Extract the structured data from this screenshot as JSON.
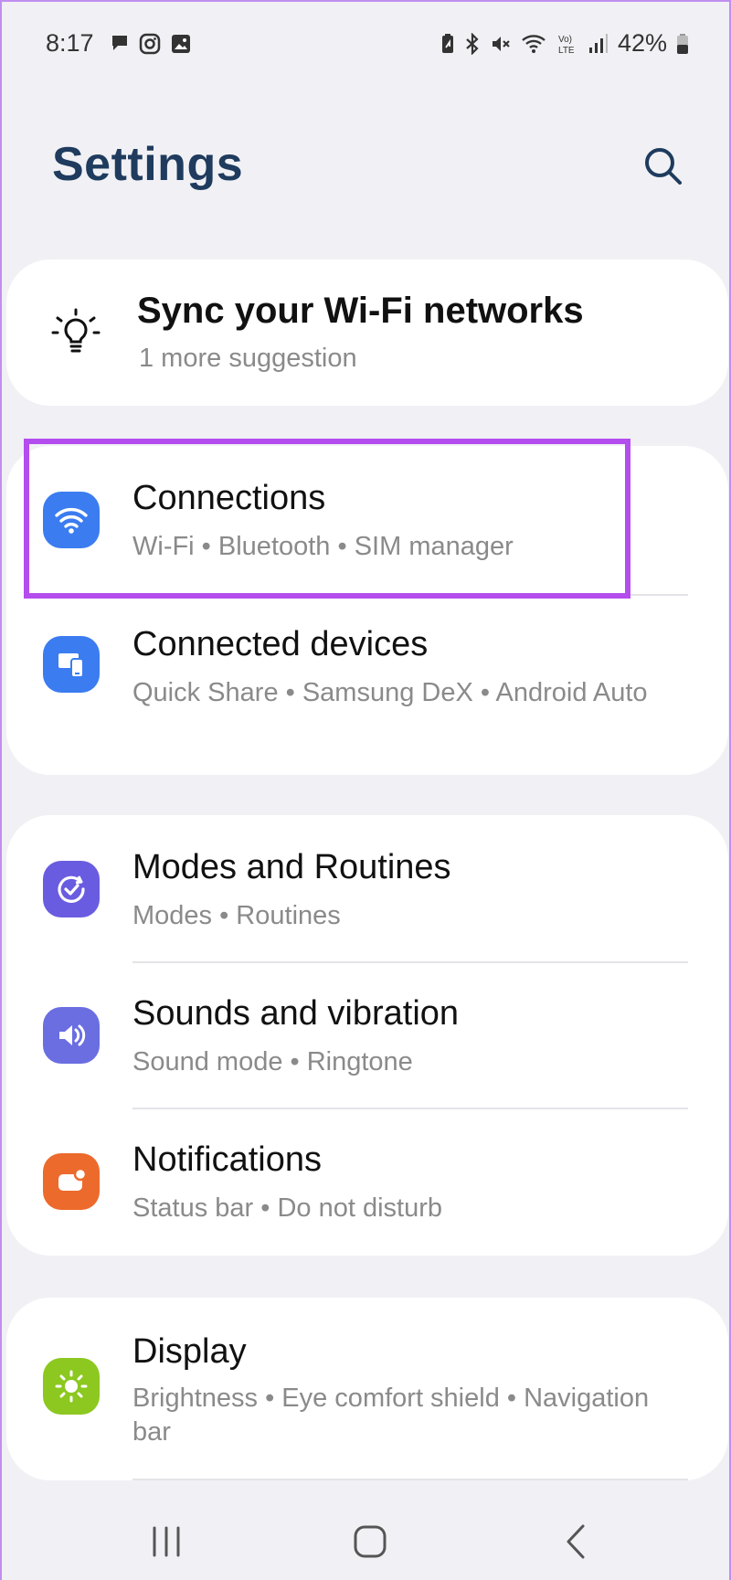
{
  "status_bar": {
    "time": "8:17",
    "battery_text": "42%",
    "left_icons": [
      "chat-icon",
      "instagram-icon",
      "gallery-icon"
    ],
    "right_icons": [
      "battery-saver-icon",
      "bluetooth-icon",
      "mute-icon",
      "wifi-icon",
      "volte-icon",
      "signal-icon",
      "battery-icon"
    ]
  },
  "header": {
    "title": "Settings",
    "search_icon": "search-icon"
  },
  "suggestion": {
    "title": "Sync your Wi-Fi networks",
    "subtitle": "1 more suggestion",
    "icon": "lightbulb-icon"
  },
  "groups": [
    {
      "items": [
        {
          "title": "Connections",
          "subtitle": "Wi-Fi  •  Bluetooth  •  SIM manager",
          "icon": "wifi-icon",
          "color": "#3b7cf0",
          "highlighted": true
        },
        {
          "title": "Connected devices",
          "subtitle": "Quick Share  •  Samsung DeX  •  Android Auto",
          "icon": "devices-icon",
          "color": "#3b7cf0"
        }
      ]
    },
    {
      "items": [
        {
          "title": "Modes and Routines",
          "subtitle": "Modes  •  Routines",
          "icon": "routines-icon",
          "color": "#6a5ce0"
        },
        {
          "title": "Sounds and vibration",
          "subtitle": "Sound mode  •  Ringtone",
          "icon": "volume-icon",
          "color": "#6a6ee0"
        },
        {
          "title": "Notifications",
          "subtitle": "Status bar  •  Do not disturb",
          "icon": "notification-icon",
          "color": "#ec6a2c"
        }
      ]
    },
    {
      "items": [
        {
          "title": "Display",
          "subtitle": "Brightness  •  Eye comfort shield  •  Navigation bar",
          "icon": "brightness-icon",
          "color": "#8cc820"
        }
      ]
    }
  ],
  "nav_bar": {
    "buttons": [
      "recents-icon",
      "home-icon",
      "back-icon"
    ]
  },
  "colors": {
    "highlight": "#b44dee",
    "title": "#1f3b5e",
    "background": "#f1f1f5"
  }
}
